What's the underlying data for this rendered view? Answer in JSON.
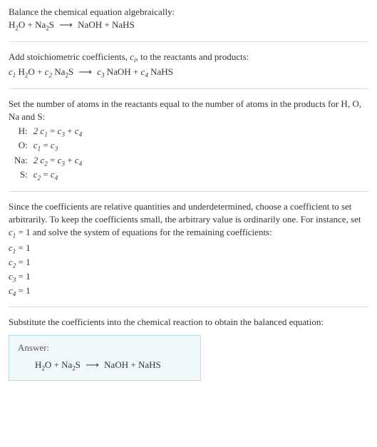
{
  "s1": {
    "line1a": "Balance the chemical equation algebraically:",
    "eq": {
      "h2o": "H",
      "h2o_sub": "2",
      "h2o_o": "O",
      "plus1": " + ",
      "na2s_na": "Na",
      "na2s_sub": "2",
      "na2s_s": "S",
      "arrow": "⟶",
      "naoh": "NaOH",
      "plus2": " + ",
      "nahs": "NaHS"
    }
  },
  "s2": {
    "line1a": "Add stoichiometric coefficients, ",
    "line1b": ", to the reactants and products:",
    "ci": "c",
    "ci_sub": "i",
    "eq": {
      "c1": "c",
      "c1s": "1",
      "sp1": " ",
      "h2o": "H",
      "h2o_sub": "2",
      "h2o_o": "O",
      "plus1": " + ",
      "c2": "c",
      "c2s": "2",
      "sp2": " ",
      "na2s_na": "Na",
      "na2s_sub": "2",
      "na2s_s": "S",
      "arrow": "⟶",
      "c3": "c",
      "c3s": "3",
      "sp3": " ",
      "naoh": "NaOH",
      "plus2": " + ",
      "c4": "c",
      "c4s": "4",
      "sp4": " ",
      "nahs": "NaHS"
    }
  },
  "s3": {
    "line1": "Set the number of atoms in the reactants equal to the number of atoms in the products for H, O, Na and S:",
    "rows": [
      {
        "label": "H:",
        "c_a": "2 c",
        "s_a": "1",
        "eq": " = ",
        "c_b": "c",
        "s_b": "3",
        "plus": " + ",
        "c_c": "c",
        "s_c": "4"
      },
      {
        "label": "O:",
        "c_a": "c",
        "s_a": "1",
        "eq": " = ",
        "c_b": "c",
        "s_b": "3",
        "plus": "",
        "c_c": "",
        "s_c": ""
      },
      {
        "label": "Na:",
        "c_a": "2 c",
        "s_a": "2",
        "eq": " = ",
        "c_b": "c",
        "s_b": "3",
        "plus": " + ",
        "c_c": "c",
        "s_c": "4"
      },
      {
        "label": "S:",
        "c_a": "c",
        "s_a": "2",
        "eq": " = ",
        "c_b": "c",
        "s_b": "4",
        "plus": "",
        "c_c": "",
        "s_c": ""
      }
    ]
  },
  "s4": {
    "para_a": "Since the coefficients are relative quantities and underdetermined, choose a coefficient to set arbitrarily. To keep the coefficients small, the arbitrary value is ordinarily one. For instance, set ",
    "c1": "c",
    "c1s": "1",
    "para_b": " = 1 and solve the system of equations for the remaining coefficients:",
    "coeffs": [
      {
        "c": "c",
        "s": "1",
        "rest": " = 1"
      },
      {
        "c": "c",
        "s": "2",
        "rest": " = 1"
      },
      {
        "c": "c",
        "s": "3",
        "rest": " = 1"
      },
      {
        "c": "c",
        "s": "4",
        "rest": " = 1"
      }
    ]
  },
  "s5": {
    "para": "Substitute the coefficients into the chemical reaction to obtain the balanced equation:",
    "answer_label": "Answer:",
    "eq": {
      "h2o": "H",
      "h2o_sub": "2",
      "h2o_o": "O",
      "plus1": " + ",
      "na2s_na": "Na",
      "na2s_sub": "2",
      "na2s_s": "S",
      "arrow": "⟶",
      "naoh": "NaOH",
      "plus2": " + ",
      "nahs": "NaHS"
    }
  }
}
